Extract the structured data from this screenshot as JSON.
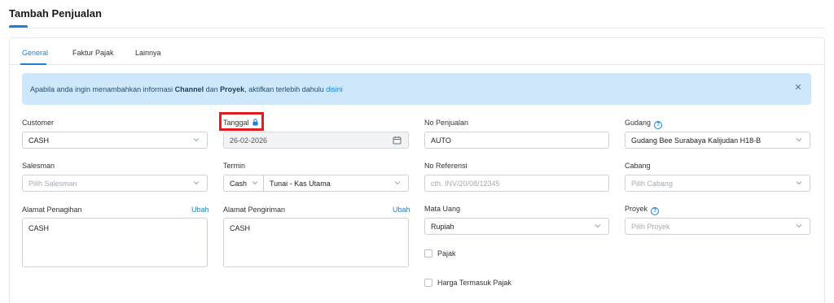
{
  "page": {
    "title": "Tambah Penjualan"
  },
  "tabs": [
    {
      "label": "General",
      "active": true
    },
    {
      "label": "Faktur Pajak",
      "active": false
    },
    {
      "label": "Lainnya",
      "active": false
    }
  ],
  "alert": {
    "text_before": "Apabila anda ingin menambahkan informasi ",
    "channel": "Channel",
    "and": " dan ",
    "proyek": "Proyek",
    "text_after": ", aktifkan terlebih dahulu ",
    "link": "disini",
    "close_icon": "close-icon"
  },
  "form": {
    "customer": {
      "label": "Customer",
      "value": "CASH"
    },
    "tanggal": {
      "label": "Tanggal",
      "value": "26-02-2026",
      "locked": true
    },
    "no_penjualan": {
      "label": "No Penjualan",
      "value": "AUTO"
    },
    "gudang": {
      "label": "Gudang",
      "value": "Gudang Bee Surabaya Kalijudan H18-B",
      "help": "?"
    },
    "salesman": {
      "label": "Salesman",
      "placeholder": "Pilih Salesman"
    },
    "termin": {
      "label": "Termin",
      "type_value": "Cash",
      "value": "Tunai - Kas Utama"
    },
    "no_referensi": {
      "label": "No Referensi",
      "placeholder": "cth. INV/20/08/12345"
    },
    "cabang": {
      "label": "Cabang",
      "placeholder": "Pilih Cabang"
    },
    "alamat_penagihan": {
      "label": "Alamat Penagihan",
      "action": "Ubah",
      "value": "CASH"
    },
    "alamat_pengiriman": {
      "label": "Alamat Pengiriman",
      "action": "Ubah",
      "value": "CASH"
    },
    "mata_uang": {
      "label": "Mata Uang",
      "value": "Rupiah"
    },
    "proyek": {
      "label": "Proyek",
      "placeholder": "Pilih Proyek",
      "help": "?"
    },
    "pajak": {
      "label": "Pajak",
      "checked": false
    },
    "harga_termasuk_pajak": {
      "label": "Harga Termasuk Pajak",
      "checked": false
    }
  },
  "colors": {
    "accent": "#1e7fd6",
    "alert_bg": "#cfe7fb",
    "highlight": "#e01c1c"
  }
}
